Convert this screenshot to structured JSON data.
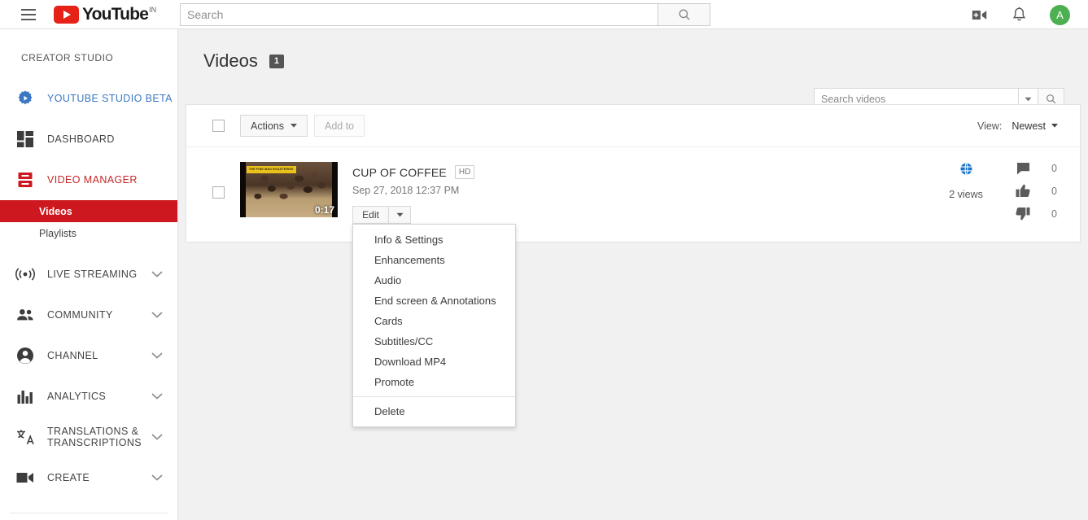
{
  "header": {
    "menu_icon": "hamburger-icon",
    "logo_text": "YouTube",
    "country_code": "IN",
    "search_placeholder": "Search",
    "search_value": "",
    "search_button_icon": "search-icon",
    "upload_icon": "video-upload-icon",
    "notifications_icon": "bell-icon",
    "avatar_letter": "A"
  },
  "sidebar": {
    "title": "CREATOR STUDIO",
    "items": [
      {
        "label": "YOUTUBE STUDIO BETA",
        "icon": "studio-gear-icon",
        "color": "#3b78c3",
        "chevron": false
      },
      {
        "label": "DASHBOARD",
        "icon": "dashboard-icon",
        "color": "#444444",
        "chevron": false
      },
      {
        "label": "VIDEO MANAGER",
        "icon": "video-manager-icon",
        "color": "#c62828",
        "chevron": false
      }
    ],
    "sub_items": [
      {
        "label": "Videos",
        "active": true
      },
      {
        "label": "Playlists",
        "active": false
      }
    ],
    "groups": [
      {
        "label": "LIVE STREAMING",
        "icon": "broadcast-icon",
        "chevron": "chevron-down-icon"
      },
      {
        "label": "COMMUNITY",
        "icon": "people-icon",
        "chevron": "chevron-down-icon"
      },
      {
        "label": "CHANNEL",
        "icon": "account-circle-icon",
        "chevron": "chevron-down-icon"
      },
      {
        "label": "ANALYTICS",
        "icon": "bar-chart-icon",
        "chevron": "chevron-down-icon"
      },
      {
        "label": "TRANSLATIONS & TRANSCRIPTIONS",
        "icon": "translate-icon",
        "chevron": "chevron-down-icon"
      },
      {
        "label": "CREATE",
        "icon": "video-camera-icon",
        "chevron": "chevron-down-icon"
      }
    ]
  },
  "main": {
    "page_title": "Videos",
    "video_count": "1",
    "search_videos_placeholder": "Search videos",
    "search_videos_value": "",
    "toolbar": {
      "actions_label": "Actions",
      "add_to_label": "Add to",
      "view_label": "View:",
      "view_value": "Newest"
    },
    "video": {
      "title": "CUP OF COFFEE",
      "hd_badge": "HD",
      "date": "Sep 27, 2018 12:37 PM",
      "duration": "0:17",
      "thumb_tag": "THE FINE MAN\nROASTERIES",
      "edit_label": "Edit",
      "privacy_icon": "globe-public-icon",
      "views": "2 views",
      "stats": [
        {
          "icon": "comment-icon",
          "value": "0"
        },
        {
          "icon": "thumbs-up-icon",
          "value": "0"
        },
        {
          "icon": "thumbs-down-icon",
          "value": "0"
        }
      ]
    },
    "edit_menu": {
      "items": [
        "Info & Settings",
        "Enhancements",
        "Audio",
        "End screen & Annotations",
        "Cards",
        "Subtitles/CC",
        "Download MP4",
        "Promote"
      ],
      "delete_label": "Delete"
    }
  },
  "colors": {
    "youtube_red": "#e62117",
    "active_red": "#cc181e",
    "studio_blue": "#3b78c3",
    "avatar_green": "#4caf50",
    "page_bg": "#f1f1f1"
  }
}
